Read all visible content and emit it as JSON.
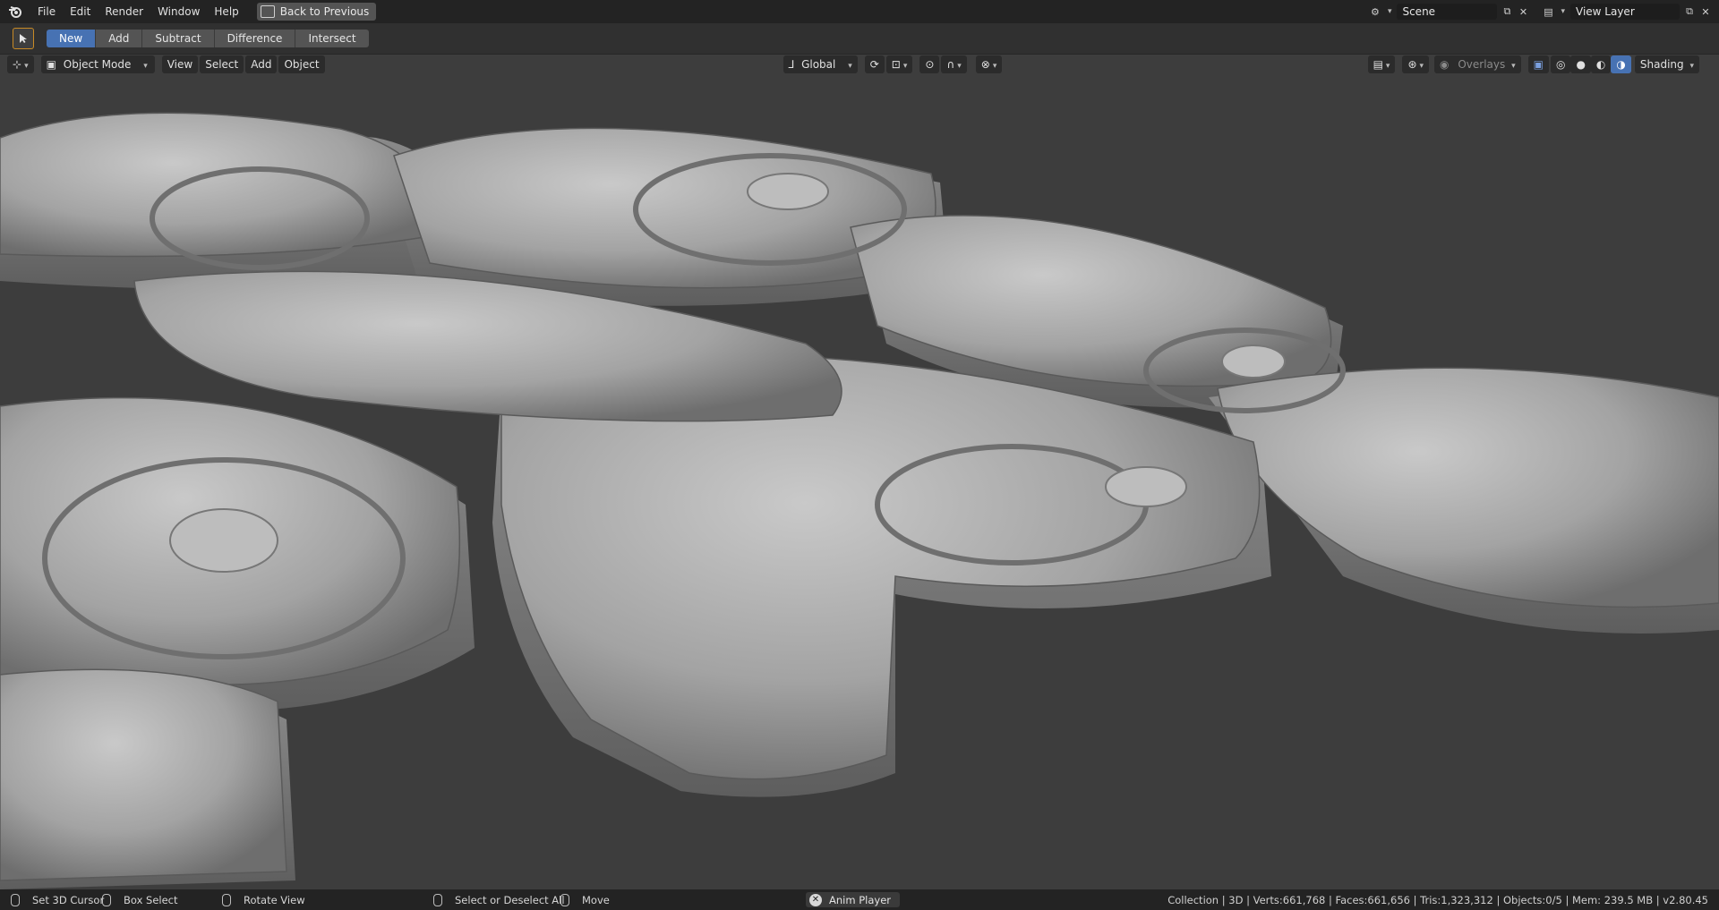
{
  "topbar": {
    "menus": [
      "File",
      "Edit",
      "Render",
      "Window",
      "Help"
    ],
    "back_button": "Back to Previous",
    "scene_name": "Scene",
    "view_layer": "View Layer"
  },
  "tool_header": {
    "modes": [
      "New",
      "Add",
      "Subtract",
      "Difference",
      "Intersect"
    ],
    "active_mode": "New"
  },
  "viewport_header": {
    "object_mode": "Object Mode",
    "menus": [
      "View",
      "Select",
      "Add",
      "Object"
    ],
    "orientation": "Global",
    "overlays": "Overlays",
    "shading": "Shading"
  },
  "statusbar": {
    "set_cursor": "Set 3D Cursor",
    "box_select": "Box Select",
    "rotate_view": "Rotate View",
    "select_all": "Select or Deselect All",
    "move": "Move",
    "anim_player": "Anim Player",
    "stats": "Collection | 3D | Verts:661,768 | Faces:661,656 | Tris:1,323,312 | Objects:0/5 | Mem: 239.5 MB | v2.80.45"
  },
  "colors": {
    "accent": "#4772b3",
    "topbar": "#232323",
    "viewport_bg": "#3d3d3d",
    "model": "#a8a8a8"
  }
}
